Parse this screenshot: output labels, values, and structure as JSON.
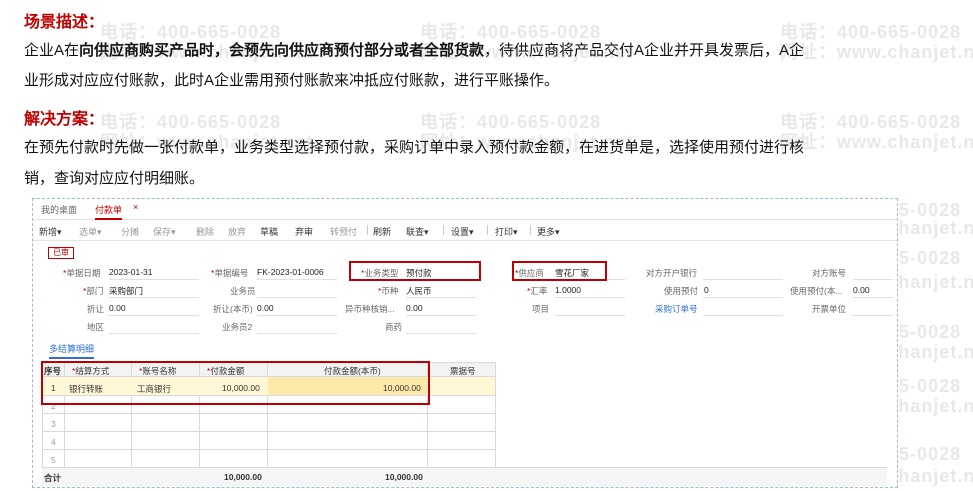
{
  "watermark": {
    "phone": "电话：400-665-0028",
    "site": "网址：www.chanjet.net"
  },
  "doc": {
    "scene_title": "场景描述：",
    "scene_p1_a": "企业A在",
    "scene_p1_b": "向供应商购买产品时，会预先向供应商预付部分或者全部货款",
    "scene_p1_c": "，待供应商将产品交付A企业并开具发票后，A企",
    "scene_p2": "业形成对应应付账款，此时A企业需用预付账款来冲抵应付账款，进行平账操作。",
    "solution_title": "解决方案：",
    "solution_p1": "在预先付款时先做一张付款单，业务类型选择预付款，采购订单中录入预付款金额，在进货单是，选择使用预付进行核",
    "solution_p2": "销，查询对应应付明细账。"
  },
  "app": {
    "tabs": {
      "home": "我的桌面",
      "current": "付款单",
      "close": "×"
    },
    "toolbar": {
      "new": "新增",
      "select": "选单",
      "split": "分摊",
      "save": "保存",
      "delete": "删除",
      "discard": "放弃",
      "draft": "草稿",
      "abandon": "弃审",
      "to_prepay": "转预付",
      "refresh": "刷新",
      "link_query": "联查",
      "settings": "设置",
      "print": "打印",
      "more": "更多"
    },
    "status": "已审",
    "form": {
      "date_label": "单据日期",
      "date_value": "2023-01-31",
      "no_label": "单据编号",
      "no_value": "FK-2023-01-0006",
      "biztype_label": "业务类型",
      "biztype_value": "预付款",
      "supplier_label": "供应商",
      "supplier_value": "雪花厂家",
      "bank_label": "对方开户银行",
      "account_label": "对方账号",
      "dept_label": "部门",
      "dept_value": "采购部门",
      "staff_label": "业务员",
      "currency_label": "币种",
      "currency_value": "人民币",
      "rate_label": "汇率",
      "rate_value": "1.0000",
      "use_prepay_label": "使用预付",
      "use_prepay_value": "0",
      "use_prepay_lc_label": "使用预付(本...",
      "use_prepay_lc_value": "0.00",
      "discount_label": "折让",
      "discount_value": "0.00",
      "discount_lc_label": "折让(本币)",
      "discount_lc_value": "0.00",
      "fx_label": "异币种核销...",
      "fx_value": "0.00",
      "project_label": "项目",
      "po_link": "采购订单号",
      "bank_unit_label": "开票单位",
      "region_label": "地区",
      "staff2_label": "业务员2",
      "merchant_label": "商药"
    },
    "detail_tab": "多结算明细",
    "table": {
      "headers": {
        "seq": "序号",
        "method": "结算方式",
        "account": "账号名称",
        "amount": "付款金额",
        "amount_lc": "付款金额(本币)",
        "invoice": "票据号"
      },
      "rows": [
        {
          "seq": "1",
          "method": "银行转账",
          "account": "工商银行",
          "amount": "10,000.00",
          "amount_lc": "10,000.00"
        },
        {
          "seq": "2"
        },
        {
          "seq": "3"
        },
        {
          "seq": "4"
        },
        {
          "seq": "5"
        }
      ],
      "total_label": "合计",
      "total_amount": "10,000.00",
      "total_amount_lc": "10,000.00"
    }
  }
}
